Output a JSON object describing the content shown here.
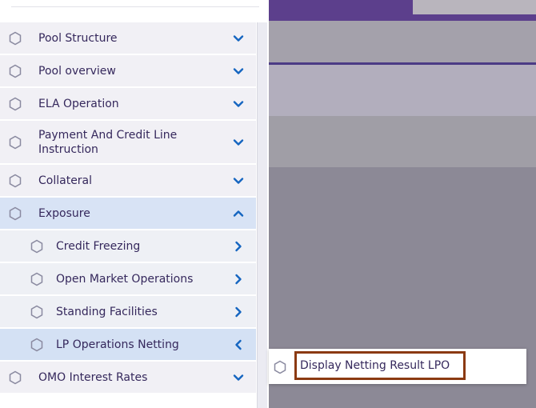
{
  "sidebar": {
    "items": [
      {
        "label": "Pool Structure",
        "icon": "hexagon-icon",
        "chevron": "chevron-down-icon"
      },
      {
        "label": "Pool overview",
        "icon": "hexagon-icon",
        "chevron": "chevron-down-icon"
      },
      {
        "label": "ELA Operation",
        "icon": "hexagon-icon",
        "chevron": "chevron-down-icon"
      },
      {
        "label": "Payment And Credit Line Instruction",
        "icon": "hexagon-icon",
        "chevron": "chevron-down-icon"
      },
      {
        "label": "Collateral",
        "icon": "hexagon-icon",
        "chevron": "chevron-down-icon"
      },
      {
        "label": "Exposure",
        "icon": "hexagon-icon",
        "chevron": "chevron-up-icon",
        "expanded": true
      },
      {
        "label": "OMO Interest Rates",
        "icon": "hexagon-icon",
        "chevron": "chevron-down-icon"
      }
    ],
    "exposure_children": [
      {
        "label": "Credit Freezing",
        "chevron": "chevron-right-icon"
      },
      {
        "label": "Open Market Operations",
        "chevron": "chevron-right-icon"
      },
      {
        "label": "Standing Facilities",
        "chevron": "chevron-right-icon"
      },
      {
        "label": "LP Operations Netting",
        "chevron": "chevron-left-icon",
        "active": true
      }
    ]
  },
  "flyout": {
    "item_label": "Display Netting Result LPO",
    "icon": "hexagon-icon"
  },
  "colors": {
    "accent": "#1565c0",
    "text": "#35285c",
    "highlight_border": "#8b3a12",
    "active_bg": "#d8e3f5",
    "topbar": "#5c3f8c"
  }
}
